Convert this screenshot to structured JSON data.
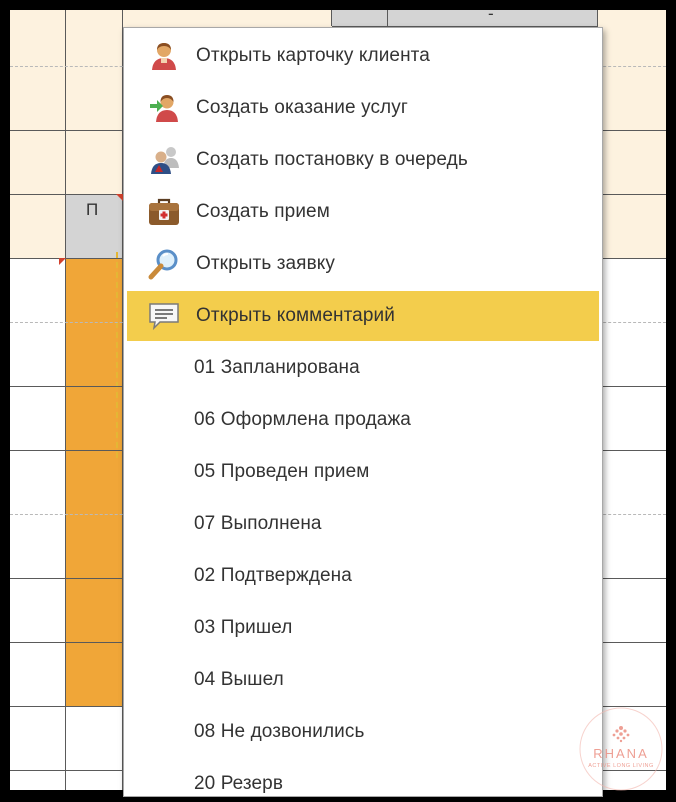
{
  "grid": {
    "header_letter": "П",
    "top_cell_text": "-"
  },
  "context_menu": {
    "items": [
      {
        "label": "Открыть карточку клиента",
        "icon": "client-person-icon",
        "active": false
      },
      {
        "label": "Создать оказание услуг",
        "icon": "person-arrow-icon",
        "active": false
      },
      {
        "label": "Создать постановку в очередь",
        "icon": "queue-people-icon",
        "active": false
      },
      {
        "label": "Создать прием",
        "icon": "medical-bag-icon",
        "active": false
      },
      {
        "label": "Открыть заявку",
        "icon": "magnifier-icon",
        "active": false
      },
      {
        "label": "Открыть комментарий",
        "icon": "comment-icon",
        "active": true
      },
      {
        "label": "01 Запланирована",
        "icon": null,
        "active": false
      },
      {
        "label": "06 Оформлена продажа",
        "icon": null,
        "active": false
      },
      {
        "label": "05 Проведен прием",
        "icon": null,
        "active": false
      },
      {
        "label": "07 Выполнена",
        "icon": null,
        "active": false
      },
      {
        "label": "02 Подтверждена",
        "icon": null,
        "active": false
      },
      {
        "label": "03 Пришел",
        "icon": null,
        "active": false
      },
      {
        "label": "04 Вышел",
        "icon": null,
        "active": false
      },
      {
        "label": "08 Не дозвонились",
        "icon": null,
        "active": false
      },
      {
        "label": "20 Резерв",
        "icon": null,
        "active": false
      }
    ]
  },
  "watermark": {
    "brand": "RHANA",
    "tagline": "ACTIVE LONG LIVING"
  },
  "colors": {
    "highlight": "#f3cd4c",
    "appointment": "#f0a638",
    "header_bg": "#fdf2df"
  }
}
